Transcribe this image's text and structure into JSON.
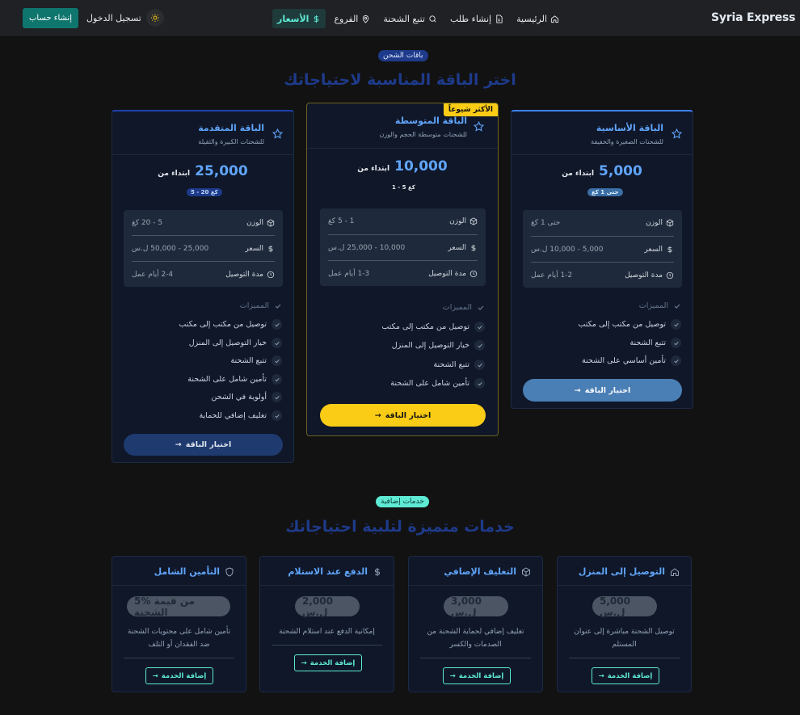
{
  "nav": {
    "brand": "Syria Express",
    "links": [
      {
        "label": "الرئيسية",
        "icon": "home-icon"
      },
      {
        "label": "إنشاء طلب",
        "icon": "file-icon"
      },
      {
        "label": "تتبع الشحنة",
        "icon": "search-icon"
      },
      {
        "label": "الفروع",
        "icon": "map-pin-icon"
      },
      {
        "label": "الأسعار",
        "icon": "dollar-icon",
        "active": true
      }
    ],
    "login": "تسجيل الدخول",
    "signup": "إنشاء حساب",
    "theme_icon": "sun-icon"
  },
  "packages": {
    "badge": "باقات الشحن",
    "title": "اختر الباقة المناسبة لاحتياجاتك",
    "popular_label": "الأكثر شيوعاً",
    "features_label": "المميزات",
    "from_label": "ابتداء من",
    "choose_label": "اختيار الباقة",
    "spec_labels": {
      "weight": "الوزن",
      "price": "السعر",
      "delivery": "مدة التوصيل"
    },
    "cards": [
      {
        "id": "basic",
        "title": "الباقة الأساسية",
        "subtitle": "للشحنات الصغيرة والخفيفة",
        "price": "5,000",
        "range": "حتى 1 كغ",
        "weight": "حتى 1 كغ",
        "price_range": "5,000 - 10,000 ل.س",
        "delivery": "1-2 أيام عمل",
        "features": [
          "توصيل من مكتب إلى مكتب",
          "تتبع الشحنة",
          "تأمين أساسي على الشحنة"
        ]
      },
      {
        "id": "medium",
        "title": "الباقة المتوسطة",
        "subtitle": "للشحنات متوسطة الحجم والوزن",
        "price": "10,000",
        "range": "1 - 5 كغ",
        "weight": "1 - 5 كغ",
        "price_range": "10,000 - 25,000 ل.س",
        "delivery": "1-3 أيام عمل",
        "features": [
          "توصيل من مكتب إلى مكتب",
          "خيار التوصيل إلى المنزل",
          "تتبع الشحنة",
          "تأمين شامل على الشحنة"
        ]
      },
      {
        "id": "advanced",
        "title": "الباقة المتقدمة",
        "subtitle": "للشحنات الكبيرة والثقيلة",
        "price": "25,000",
        "range": "5 - 20 كغ",
        "weight": "5 - 20 كغ",
        "price_range": "25,000 - 50,000 ل.س",
        "delivery": "2-4 أيام عمل",
        "features": [
          "توصيل من مكتب إلى مكتب",
          "خيار التوصيل إلى المنزل",
          "تتبع الشحنة",
          "تأمين شامل على الشحنة",
          "أولوية في الشحن",
          "تغليف إضافي للحماية"
        ]
      }
    ]
  },
  "services": {
    "badge": "خدمات إضافية",
    "title": "خدمات متميزة لتلبية احتياجاتك",
    "add_label": "إضافة الخدمة",
    "items": [
      {
        "title": "التوصيل إلى المنزل",
        "icon": "home-icon",
        "price": "5,000 ل.س",
        "desc": "توصيل الشحنة مباشرة إلى عنوان المستلم"
      },
      {
        "title": "التغليف الإضافي",
        "icon": "box-icon",
        "price": "3,000 ل.س",
        "desc": "تغليف إضافي لحماية الشحنة من الصدمات والكسر"
      },
      {
        "title": "الدفع عند الاستلام",
        "icon": "dollar-icon",
        "price": "2,000 ل.س",
        "desc": "إمكانية الدفع عند استلام الشحنة"
      },
      {
        "title": "التأمين الشامل",
        "icon": "shield-icon",
        "price": "5% من قيمة الشحنة",
        "desc": "تأمين شامل على محتويات الشحنة ضد الفقدان أو التلف"
      }
    ]
  },
  "colors": {
    "accent": "#60a5fa",
    "teal": "#0f766e",
    "popular": "#facc15",
    "page_bg": "#121212",
    "card_bg": "#0f1729"
  }
}
